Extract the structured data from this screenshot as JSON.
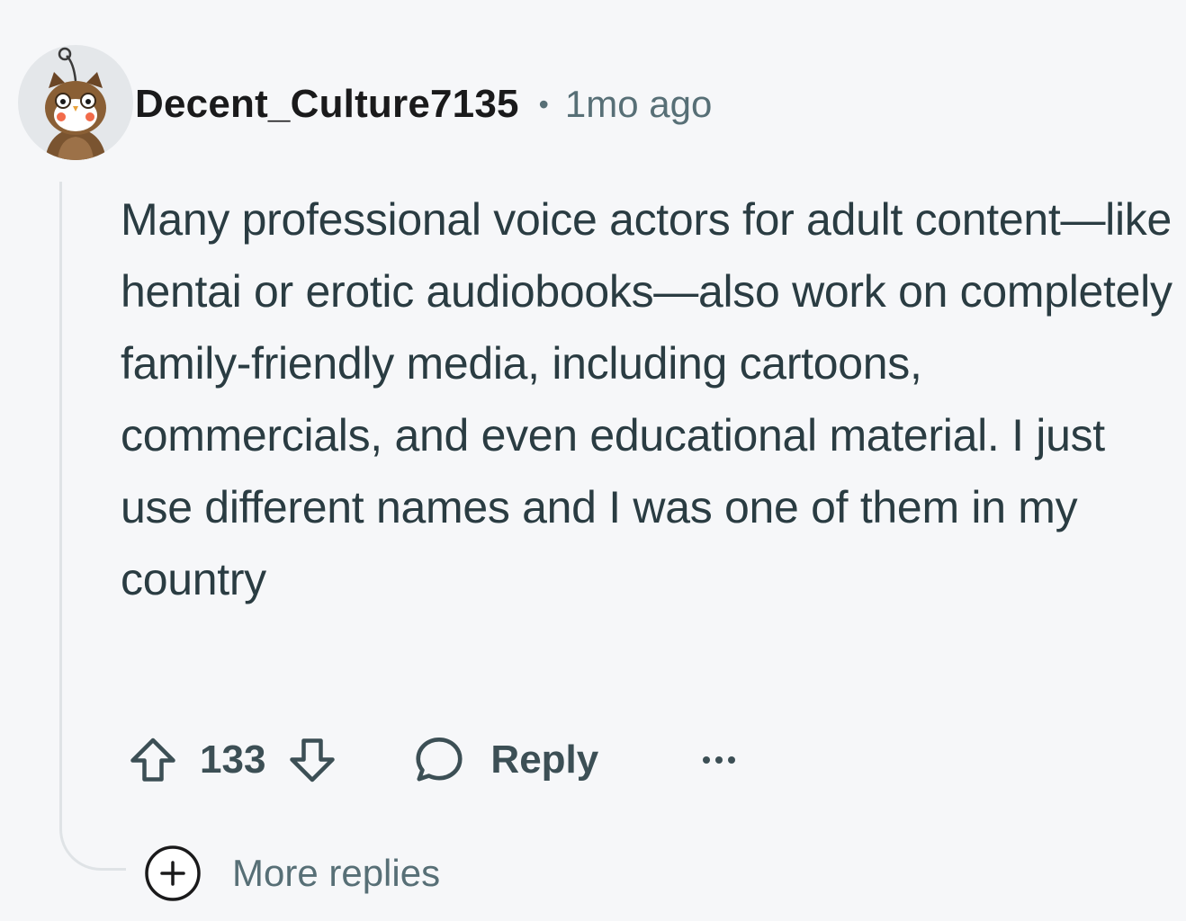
{
  "comment": {
    "author": "Decent_Culture7135",
    "separator": "•",
    "timestamp": "1mo ago",
    "body": "Many professional voice actors for adult content—like hentai or erotic audiobooks—also work on completely family-friendly media, including cartoons, commercials, and even educational material. I just use different names and I was one of them in my country",
    "vote_count": "133",
    "reply_label": "Reply",
    "more_replies_label": "More replies"
  },
  "icons": {
    "avatar": "snoo-owl-avatar",
    "upvote": "arrow-up-outline-icon",
    "downvote": "arrow-down-outline-icon",
    "reply": "speech-bubble-icon",
    "more": "ellipsis-icon",
    "expand": "plus-circle-icon"
  },
  "colors": {
    "background": "#f6f7f9",
    "text_primary": "#1a1a1b",
    "text_body": "#2a3c42",
    "text_meta": "#576f76",
    "thread_line": "#dfe3e6"
  }
}
